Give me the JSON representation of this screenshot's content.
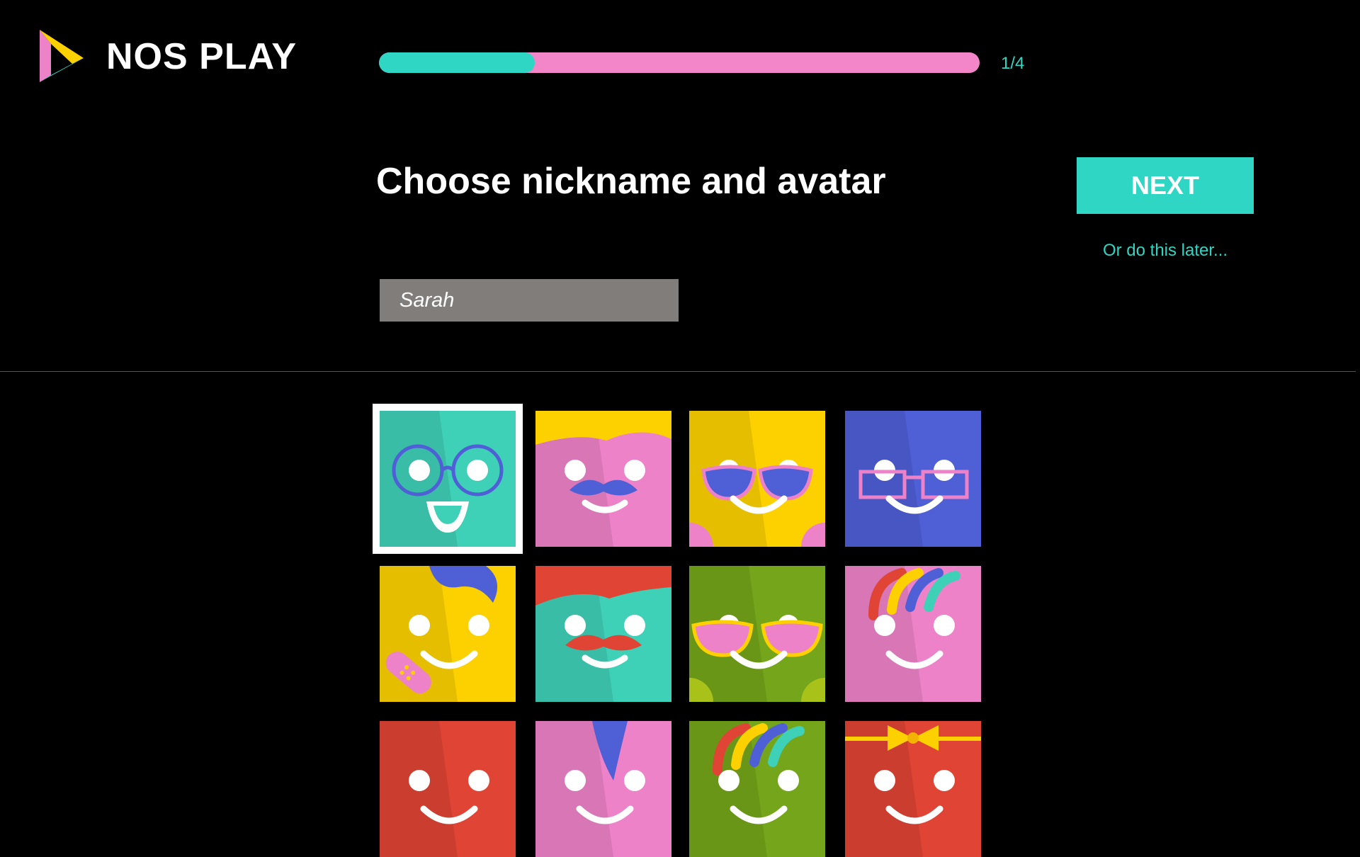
{
  "app": {
    "name": "NOS PLAY"
  },
  "progress": {
    "fraction": 0.26,
    "step_label": "1/4"
  },
  "page": {
    "title": "Choose nickname and avatar"
  },
  "actions": {
    "next_label": "NEXT",
    "later_label": "Or do this later..."
  },
  "nickname": {
    "value": "Sarah"
  },
  "avatars": [
    {
      "color": "#3fd0b8",
      "accessory": "round-glasses",
      "selected": true
    },
    {
      "color": "#ee82c8",
      "accessory": "blonde-hair-blue-mustache",
      "selected": false
    },
    {
      "color": "#fdd100",
      "accessory": "blue-sunglasses",
      "selected": false
    },
    {
      "color": "#4f5fd6",
      "accessory": "pink-rect-glasses",
      "selected": false
    },
    {
      "color": "#fdd100",
      "accessory": "blue-hair-bandage",
      "selected": false
    },
    {
      "color": "#3fd0b8",
      "accessory": "red-hair-red-mustache",
      "selected": false
    },
    {
      "color": "#74a51a",
      "accessory": "pink-sunglasses",
      "selected": false
    },
    {
      "color": "#ee82c8",
      "accessory": "rainbow-hair",
      "selected": false
    },
    {
      "color": "#e04434",
      "accessory": "plain",
      "selected": false
    },
    {
      "color": "#ee82c8",
      "accessory": "blue-hair",
      "selected": false
    },
    {
      "color": "#74a51a",
      "accessory": "rainbow-hair",
      "selected": false
    },
    {
      "color": "#e04434",
      "accessory": "yellow-bowtie",
      "selected": false
    }
  ],
  "colors": {
    "accent": "#2fd6c4",
    "progress_track": "#f286c8",
    "input_bg": "#817d7b"
  }
}
